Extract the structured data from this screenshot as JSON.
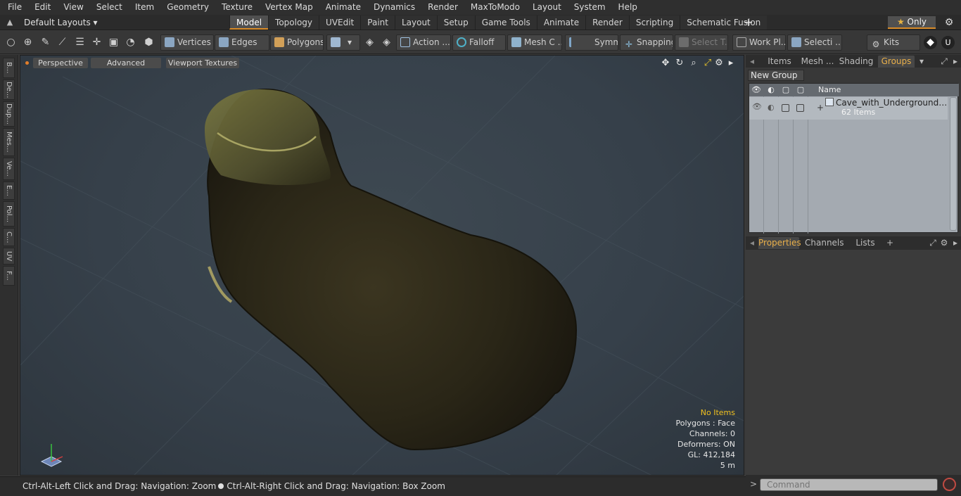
{
  "menubar": {
    "items": [
      "File",
      "Edit",
      "View",
      "Select",
      "Item",
      "Geometry",
      "Texture",
      "Vertex Map",
      "Animate",
      "Dynamics",
      "Render",
      "MaxToModo",
      "Layout",
      "System",
      "Help"
    ]
  },
  "layoutbar": {
    "layout_select": "Default Layouts ▾",
    "tabs": [
      "Model",
      "Topology",
      "UVEdit",
      "Paint",
      "Layout",
      "Setup",
      "Game Tools",
      "Animate",
      "Render",
      "Scripting",
      "Schematic Fusion"
    ],
    "active_tab": "Model",
    "add_tab": "+",
    "only_label": "Only",
    "only_star": "★"
  },
  "toolbar": {
    "vertices": "Vertices",
    "edges": "Edges",
    "polygons": "Polygons",
    "action": "Action ...",
    "falloff": "Falloff",
    "mesh": "Mesh C ...",
    "symm": "Symm ...",
    "snapping": "Snapping",
    "select_t": "Select T...",
    "work_plane": "Work Pl...",
    "selection": "Selecti ...",
    "kits": "Kits"
  },
  "left_tabs": [
    "B...",
    "De...",
    "Dup...",
    "Mes...",
    "Ve...",
    "E...",
    "Pol...",
    "C...",
    "UV",
    "F..."
  ],
  "viewport": {
    "perspective": "Perspective",
    "advanced": "Advanced",
    "textures": "Viewport Textures",
    "info": {
      "no_items": "No Items",
      "polygons": "Polygons : Face",
      "channels": "Channels: 0",
      "deformers": "Deformers: ON",
      "gl": "GL: 412,184",
      "scale": "5 m"
    }
  },
  "statusbar": {
    "hint_left": "Ctrl-Alt-Left Click and Drag: Navigation: Zoom",
    "hint_right": "Ctrl-Alt-Right Click and Drag: Navigation: Box Zoom"
  },
  "right_panel": {
    "tabs": [
      "Items",
      "Mesh ...",
      "Shading",
      "Groups"
    ],
    "active_tab": "Groups",
    "new_group": "New Group",
    "column_name": "Name",
    "group": {
      "name": "Cave_with_Underground_Lak...",
      "count": "62 Items"
    },
    "props_tabs": [
      "Properties",
      "Channels",
      "Lists"
    ],
    "props_add": "+",
    "command_placeholder": "Command"
  },
  "colors": {
    "accent": "#d88a27",
    "warn_text": "#f0c020",
    "active_tab_text": "#eab04a"
  }
}
